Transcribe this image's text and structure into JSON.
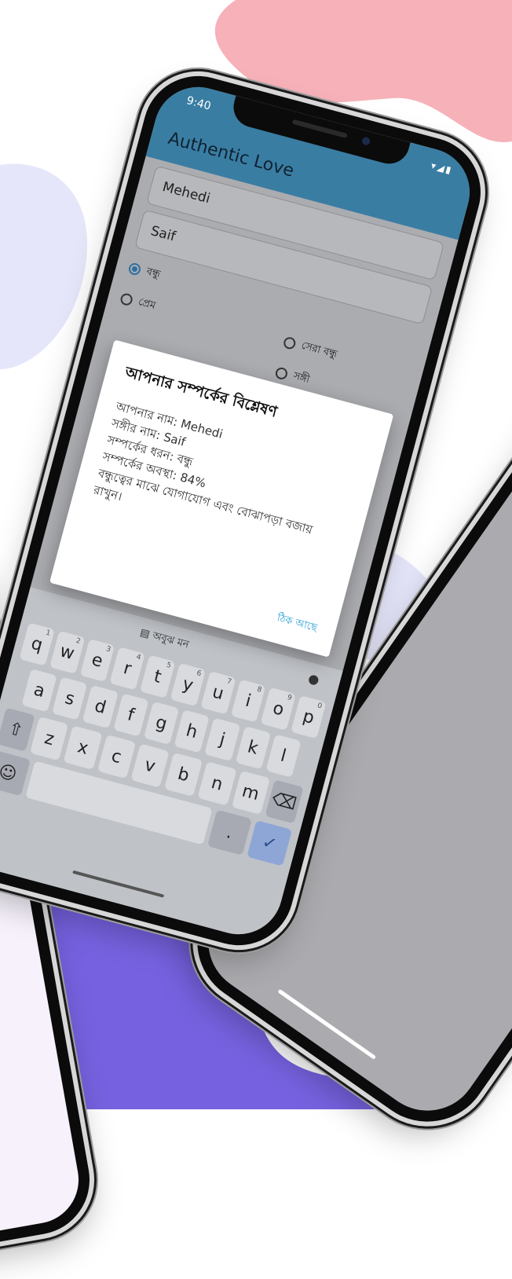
{
  "status": {
    "time": "9:40",
    "icons": "▾◢▮"
  },
  "app": {
    "title": "Authentic Love"
  },
  "form": {
    "your_name_value": "Mehedi",
    "partner_name_value": "Saif",
    "relationship_types": [
      {
        "label": "বন্ধু",
        "selected": true
      },
      {
        "label": "প্রেম",
        "selected": false
      },
      {
        "label": "সেরা বন্ধু",
        "selected": false
      },
      {
        "label": "সঙ্গী",
        "selected": false
      }
    ]
  },
  "dialog": {
    "title": "আপনার সম্পর্কের বিশ্লেষণ",
    "line_name": "আপনার নাম: Mehedi",
    "line_partner": "সঙ্গীর নাম: Saif",
    "line_type": "সম্পর্কের ধরন: বন্ধু",
    "line_status": "সম্পর্কের অবস্থা: 84%",
    "line_advice": "বন্ধুত্বের মাঝে যোগাযোগ এবং বোঝাপড়া বজায় রাখুন।",
    "ok_label": "ঠিক আছে"
  },
  "keyboard": {
    "clipboard_label": "অবুঝ মন",
    "row1": [
      {
        "k": "q",
        "h": "1"
      },
      {
        "k": "w",
        "h": "2"
      },
      {
        "k": "e",
        "h": "3"
      },
      {
        "k": "r",
        "h": "4"
      },
      {
        "k": "t",
        "h": "5"
      },
      {
        "k": "y",
        "h": "6"
      },
      {
        "k": "u",
        "h": "7"
      },
      {
        "k": "i",
        "h": "8"
      },
      {
        "k": "o",
        "h": "9"
      },
      {
        "k": "p",
        "h": "0"
      }
    ],
    "row2": [
      "a",
      "s",
      "d",
      "f",
      "g",
      "h",
      "j",
      "k",
      "l"
    ],
    "row3": [
      "z",
      "x",
      "c",
      "v",
      "b",
      "n",
      "m"
    ],
    "period": "."
  },
  "colors": {
    "appbar": "#3a7da3",
    "accent": "#2a9fd6",
    "blob_pink": "#f7b1b8",
    "blob_lavender": "#e6e6fb",
    "blob_purple": "#7662e0"
  },
  "icons": {
    "signal": "signal-icon",
    "wifi": "wifi-icon",
    "battery": "battery-icon",
    "mic": "mic-icon",
    "clipboard": "clipboard-icon",
    "backspace": "backspace-icon",
    "enter": "check-icon",
    "emoji": "emoji-icon"
  }
}
